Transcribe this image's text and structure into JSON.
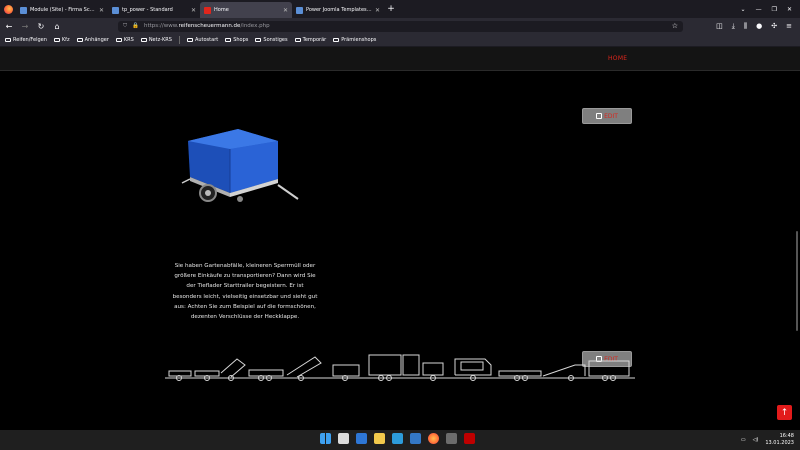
{
  "browser": {
    "tabs": [
      {
        "title": "Module (Site) - Firma Scheuerm...",
        "favicon_color": "#3b5998",
        "active": false
      },
      {
        "title": "tp_power - Standard",
        "favicon_color": "#3b5998",
        "active": false
      },
      {
        "title": "Home",
        "favicon_color": "#e0261c",
        "active": true
      },
      {
        "title": "Power Joomla Templates - Powe...",
        "favicon_color": "#3b5998",
        "active": false
      }
    ],
    "url": {
      "prefix": "https://www.",
      "domain": "reifenscheuermann.de",
      "path": "/index.php"
    },
    "bookmarks": [
      "Reifen/Felgen",
      "Kfz",
      "Anhänger",
      "KRS",
      "Netz-KRS",
      "Autostart",
      "Shops",
      "Sonstiges",
      "Temporär",
      "Prämienshops"
    ]
  },
  "site": {
    "nav_home": "HOME",
    "edit_label": "EDIT",
    "description": "Sie haben Gartenabfälle, kleineren Sperrmüll oder größere Einkäufe zu transportieren? Dann wird Sie der Tieflader Starttrailer begeistern. Er ist besonders leicht, vielseitig einsetzbar und sieht gut aus: Achten Sie zum Beispiel auf die formschönen, dezenten Verschlüsse der Heckklappe."
  },
  "taskbar": {
    "time": "16:48",
    "date": "13.01.2023"
  },
  "colors": {
    "accent": "#e0261c",
    "edit_button": "#7f7f7f"
  }
}
